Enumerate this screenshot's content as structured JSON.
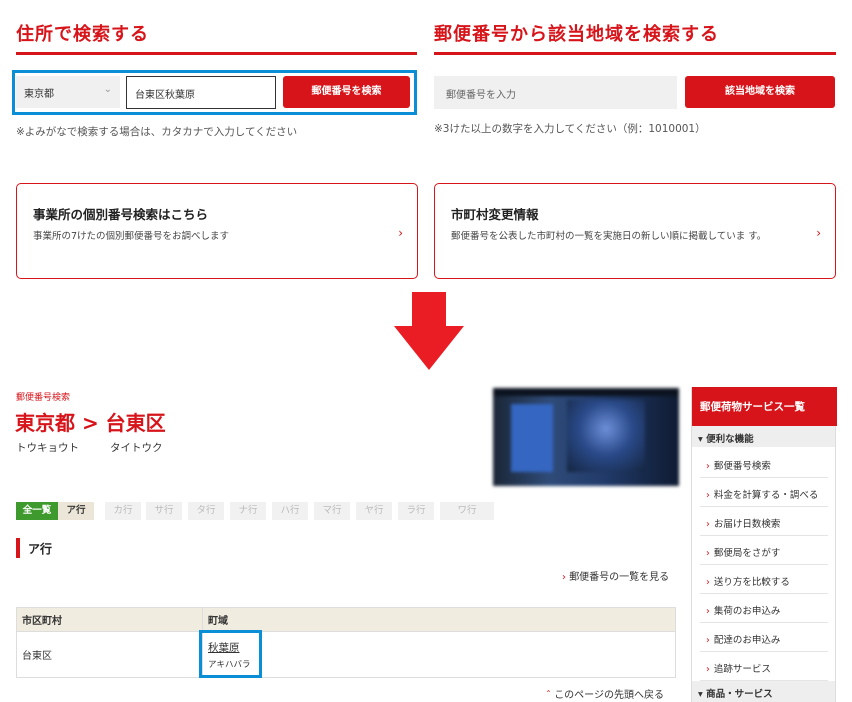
{
  "address_search": {
    "title": "住所で検索する",
    "prefecture_selected": "東京都",
    "address_value": "台東区秋葉原",
    "search_button": "郵便番号を検索",
    "note": "※よみがなで検索する場合は、カタカナで入力してください"
  },
  "zip_search": {
    "title": "郵便番号から該当地域を検索する",
    "placeholder": "郵便番号を入力",
    "search_button": "該当地域を検索",
    "note": "※3けた以上の数字を入力してください（例：1010001）"
  },
  "cards": [
    {
      "title": "事業所の個別番号検索はこちら",
      "desc": "事業所の7けたの個別郵便番号をお調べします"
    },
    {
      "title": "市町村変更情報",
      "desc": "郵便番号を公表した市町村の一覧を実施日の新しい順に掲載していま す。"
    }
  ],
  "colors": {
    "brand_red": "#d7141a",
    "highlight_blue": "#0a8ed6",
    "tab_green": "#3f9a2e"
  },
  "result": {
    "breadcrumb": "郵便番号検索",
    "heading": "東京都 > 台東区",
    "pref_kana": "トウキョウト",
    "city_kana": "タイトウク",
    "tabs": [
      "全一覧",
      "ア行",
      "カ行",
      "サ行",
      "タ行",
      "ナ行",
      "ハ行",
      "マ行",
      "ヤ行",
      "ラ行",
      "ワ行"
    ],
    "section_label": "ア行",
    "list_link": "郵便番号の一覧を見る",
    "table": {
      "headers": [
        "市区町村",
        "町域"
      ],
      "rows": [
        {
          "city": "台東区",
          "town": "秋葉原",
          "town_kana": "アキハバラ"
        }
      ]
    },
    "page_top_link": "このページの先頭へ戻る"
  },
  "sidebar": {
    "title": "郵便荷物サービス一覧",
    "group1": "便利な機能",
    "items": [
      "郵便番号検索",
      "料金を計算する・調べる",
      "お届け日数検索",
      "郵便局をさがす",
      "送り方を比較する",
      "集荷のお申込み",
      "配達のお申込み",
      "追跡サービス"
    ],
    "group2": "商品・サービス"
  }
}
